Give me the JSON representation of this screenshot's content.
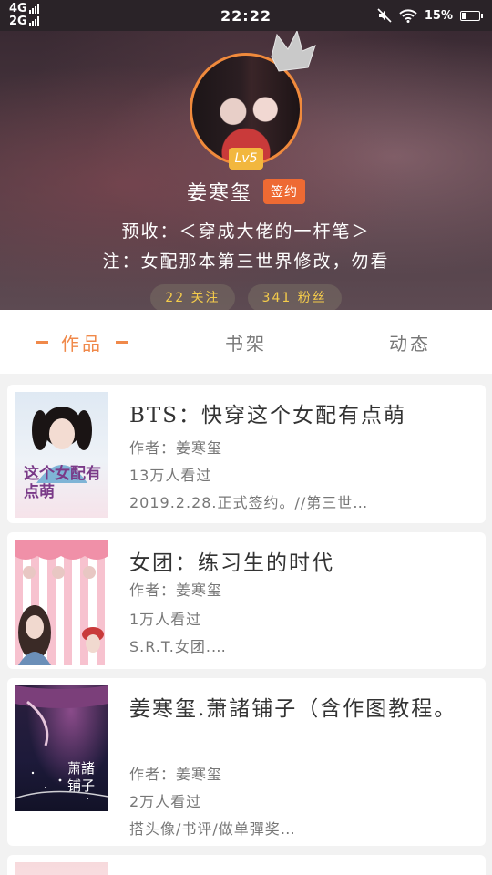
{
  "status_bar": {
    "network_top": "4G",
    "network_bottom": "2G",
    "time": "22:22",
    "battery": "15%"
  },
  "profile": {
    "level": "Lv5",
    "username": "姜寒玺",
    "signed_badge": "签约",
    "bio_line1": "预收：＜穿成大佬的一杆笔＞",
    "bio_line2": "注：女配那本第三世界修改，勿看",
    "following": "22 关注",
    "followers": "341 粉丝",
    "accent_color": "#f08a3c",
    "badge_color": "#ee6a33",
    "stat_color": "#f5cc4b"
  },
  "tabs": [
    {
      "label": "作品",
      "active": true
    },
    {
      "label": "书架",
      "active": false
    },
    {
      "label": "动态",
      "active": false
    }
  ],
  "books": [
    {
      "title": "BTS：快穿这个女配有点萌",
      "author": "作者：姜寒玺",
      "views": "13万人看过",
      "desc": "2019.2.28.正式签约。//第三世…",
      "cover_text": "这个女配有点萌"
    },
    {
      "title": "女团：练习生的时代",
      "author": "作者：姜寒玺",
      "views": "1万人看过",
      "desc": "S.R.T.女团.…",
      "cover_text": ""
    },
    {
      "title": "姜寒玺.萧諸铺子（含作图教程。",
      "author": "作者：姜寒玺",
      "views": "2万人看过",
      "desc": "搭头像/书评/做单彈奖…",
      "cover_text": "萧諸铺子"
    }
  ]
}
